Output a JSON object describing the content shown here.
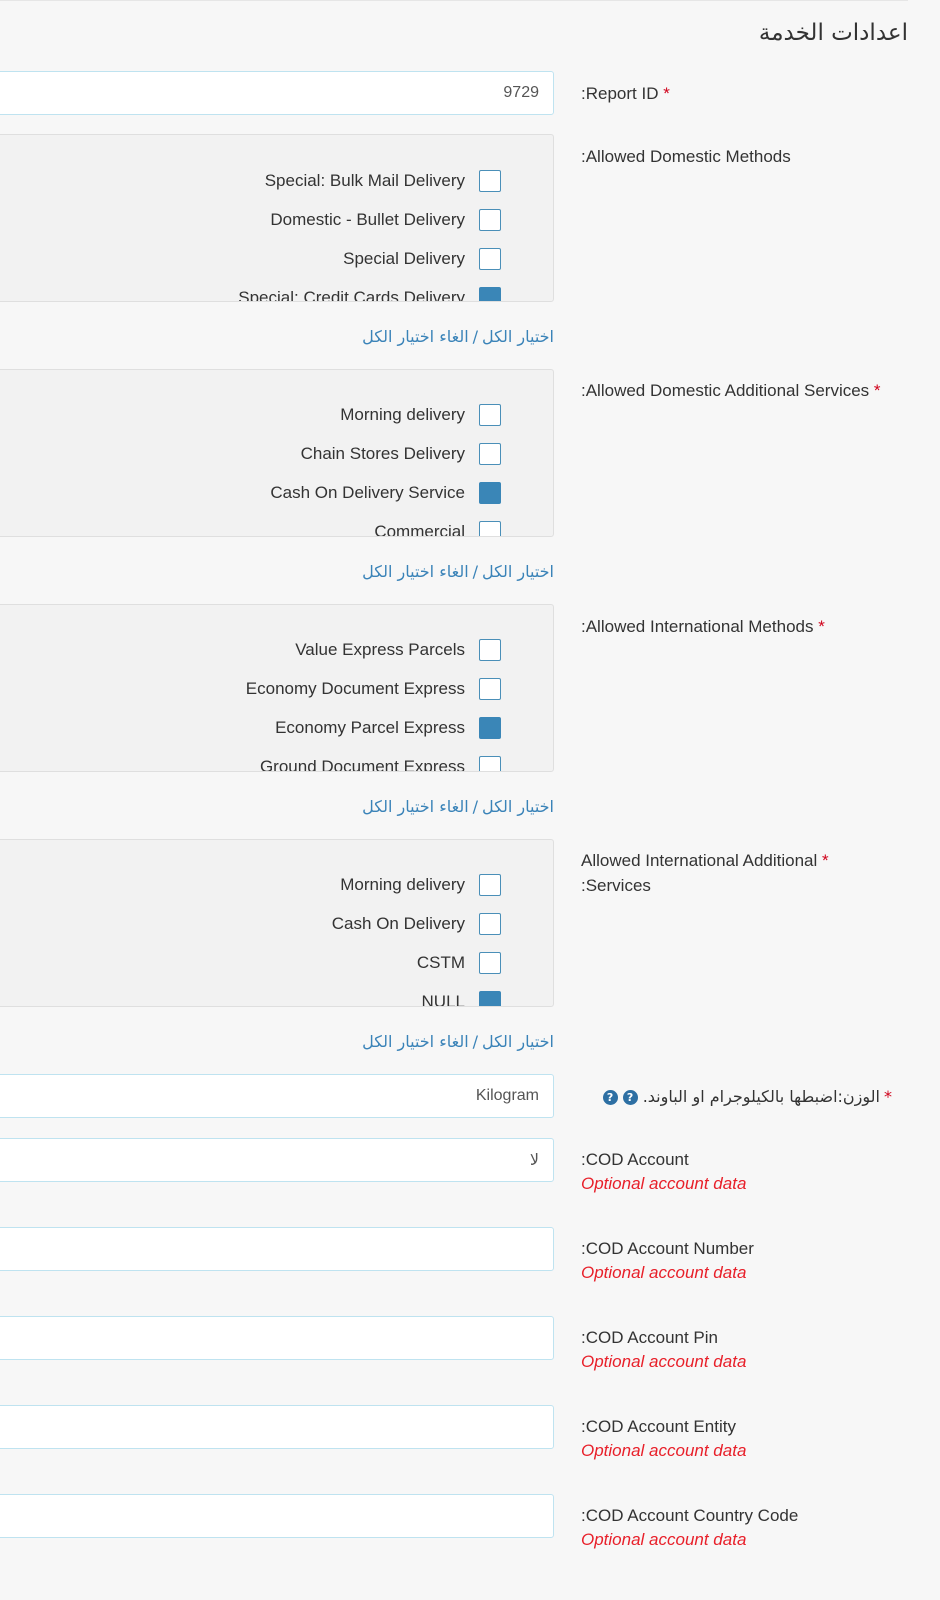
{
  "section_title": "اعدادات الخدمة",
  "report_id": {
    "label": ":Report ID",
    "value": "9729"
  },
  "domestic_methods": {
    "label": ":Allowed Domestic Methods",
    "options": [
      {
        "label": "Special: Bulk Mail Delivery",
        "checked": false
      },
      {
        "label": "Domestic - Bullet Delivery",
        "checked": false
      },
      {
        "label": "Special Delivery",
        "checked": false
      },
      {
        "label": "Special: Credit Cards Delivery",
        "checked": true
      }
    ]
  },
  "domestic_services": {
    "label": ":Allowed Domestic Additional Services",
    "options": [
      {
        "label": "Morning delivery",
        "checked": false
      },
      {
        "label": "Chain Stores Delivery",
        "checked": false
      },
      {
        "label": "Cash On Delivery Service",
        "checked": true
      },
      {
        "label": "Commercial",
        "checked": false
      }
    ]
  },
  "international_methods": {
    "label": ":Allowed International Methods",
    "options": [
      {
        "label": "Value Express Parcels",
        "checked": false
      },
      {
        "label": "Economy Document Express",
        "checked": false
      },
      {
        "label": "Economy Parcel Express",
        "checked": true
      },
      {
        "label": "Ground Document Express",
        "checked": false
      }
    ]
  },
  "international_services": {
    "label_line1": "Allowed International Additional",
    "label_line2": ":Services",
    "options": [
      {
        "label": "Morning delivery",
        "checked": false
      },
      {
        "label": "Cash On Delivery",
        "checked": false
      },
      {
        "label": "CSTM",
        "checked": false
      },
      {
        "label": "NULL",
        "checked": true
      }
    ]
  },
  "select_links": {
    "select_all": "اختيار الكل",
    "separator": "/",
    "deselect_all": "الغاء اختيار الكل"
  },
  "weight": {
    "label": "الوزن:اضبطها بالكيلوجرام او الباوند.",
    "value": "Kilogram",
    "help_glyph": "?"
  },
  "cod_account": {
    "label": ":COD Account",
    "value": "لا",
    "note": "Optional account data"
  },
  "cod_account_number": {
    "label": ":COD Account Number",
    "value": "",
    "note": "Optional account data"
  },
  "cod_account_pin": {
    "label": ":COD Account Pin",
    "value": "",
    "note": "Optional account data"
  },
  "cod_account_entity": {
    "label": ":COD Account Entity",
    "value": "",
    "note": "Optional account data"
  },
  "cod_account_country_code": {
    "label": ":COD Account Country Code",
    "value": "",
    "note": "Optional account data"
  },
  "required_mark": "*",
  "colors": {
    "accent": "#3a86b7",
    "link": "#3a83b8",
    "required": "#d0021b",
    "optional_note": "#e8202a",
    "input_border": "#bfe3f0"
  }
}
